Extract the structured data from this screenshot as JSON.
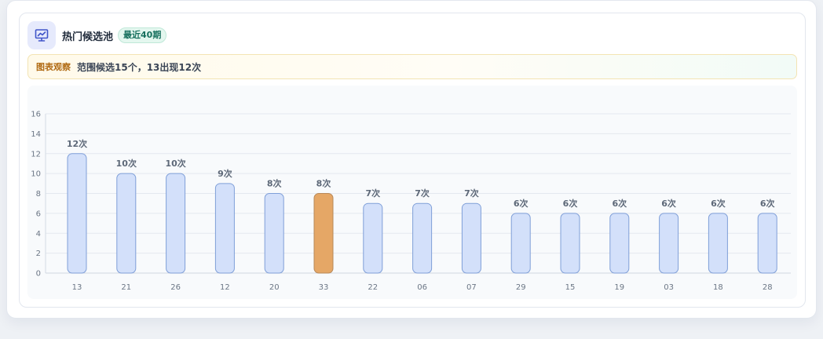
{
  "header": {
    "icon": "chart-board-icon",
    "title": "热门候选池",
    "badge": "最近40期"
  },
  "insight": {
    "tag": "图表观察",
    "text": "范围候选15个，13出现12次"
  },
  "colors": {
    "bar_fill": "#d3e0fa",
    "bar_stroke": "#7f9fd8",
    "highlight_fill": "#e5a766",
    "highlight_stroke": "#b8895a",
    "grid": "#e4e8ef",
    "accent_icon": "#4055c9"
  },
  "chart_data": {
    "type": "bar",
    "categories": [
      "13",
      "21",
      "26",
      "12",
      "20",
      "33",
      "22",
      "06",
      "07",
      "29",
      "15",
      "19",
      "03",
      "18",
      "28"
    ],
    "values": [
      12,
      10,
      10,
      9,
      8,
      8,
      7,
      7,
      7,
      6,
      6,
      6,
      6,
      6,
      6
    ],
    "data_labels": [
      "12次",
      "10次",
      "10次",
      "9次",
      "8次",
      "8次",
      "7次",
      "7次",
      "7次",
      "6次",
      "6次",
      "6次",
      "6次",
      "6次",
      "6次"
    ],
    "highlighted_category": "33",
    "ylim": [
      0,
      16
    ],
    "yticks": [
      "0",
      "2",
      "4",
      "6",
      "8",
      "10",
      "12",
      "14",
      "16"
    ],
    "grid": true,
    "legend": "none",
    "title": "",
    "xlabel": "",
    "ylabel": ""
  }
}
